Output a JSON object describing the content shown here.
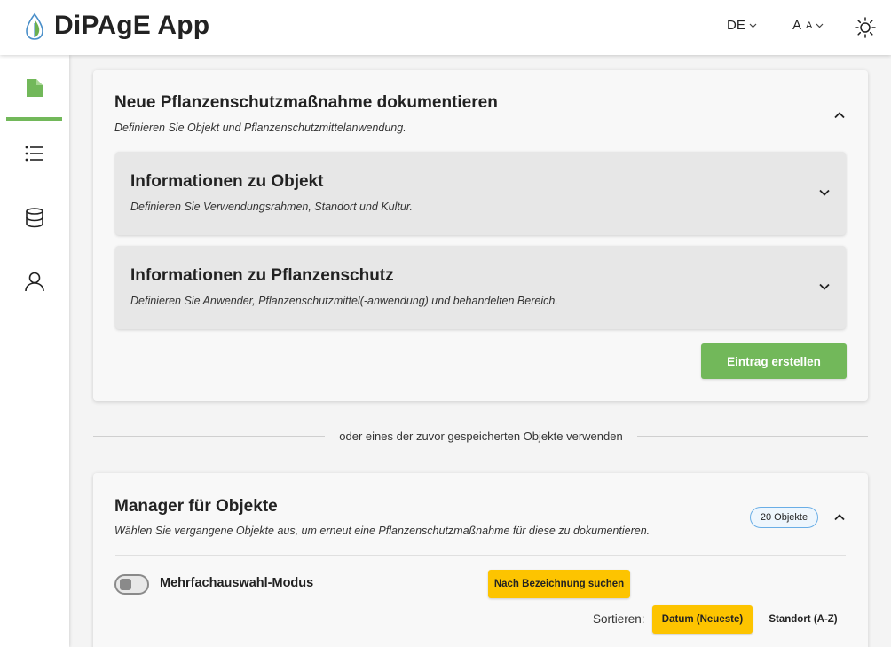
{
  "header": {
    "app_title": "DiPAgE App",
    "language": "DE",
    "font_size_big": "A",
    "font_size_small": "A",
    "logo_icon": "leaf-drop-icon",
    "theme_icon": "sun-icon"
  },
  "sidebar": {
    "items": [
      {
        "icon": "document-icon",
        "active": true
      },
      {
        "icon": "list-icon",
        "active": false
      },
      {
        "icon": "database-icon",
        "active": false
      },
      {
        "icon": "user-icon",
        "active": false
      }
    ]
  },
  "new_entry": {
    "title": "Neue Pflanzenschutzmaßnahme dokumentieren",
    "subtitle": "Definieren Sie Objekt und Pflanzenschutzmittelanwendung.",
    "object_panel": {
      "title": "Informationen zu Objekt",
      "description": "Definieren Sie Verwendungsrahmen, Standort und Kultur."
    },
    "protection_panel": {
      "title": "Informationen zu Pflanzenschutz",
      "description": "Definieren Sie Anwender, Pflanzenschutzmittel(-anwendung) und behandelten Bereich."
    },
    "create_button": "Eintrag erstellen"
  },
  "divider_text": "oder eines der zuvor gespeicherten Objekte verwenden",
  "manager": {
    "title": "Manager für Objekte",
    "subtitle": "Wählen Sie vergangene Objekte aus, um erneut eine Pflanzenschutzmaßnahme für diese zu dokumentieren.",
    "count_badge": "20 Objekte",
    "multi_select_label": "Mehrfachauswahl-Modus",
    "search_button": "Nach Bezeichnung suchen",
    "sort_label": "Sortieren:",
    "sort_date": "Datum (Neueste)",
    "sort_location": "Standort (A-Z)"
  },
  "colors": {
    "accent_green": "#72b85a",
    "button_yellow": "#fdc400",
    "badge_border": "#6aaee6"
  }
}
